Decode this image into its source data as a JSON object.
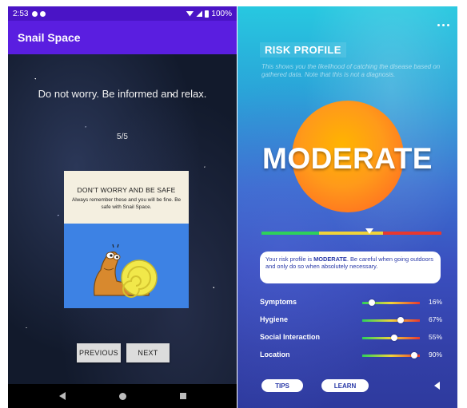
{
  "left_screen": {
    "status_bar": {
      "time": "2:53",
      "battery": "100%"
    },
    "app_title": "Snail Space",
    "headline": "Do not worry. Be informed and relax.",
    "page_counter": "5/5",
    "card": {
      "title": "DON'T WORRY AND BE SAFE",
      "body": "Always remember these and you will be fine. Be safe with Snail Space."
    },
    "buttons": {
      "previous": "PREVIOUS",
      "next": "NEXT"
    },
    "icons": [
      "notification-icon",
      "settings-icon",
      "wifi-icon",
      "signal-icon",
      "battery-icon",
      "back-icon",
      "home-icon",
      "recent-apps-icon"
    ]
  },
  "right_screen": {
    "title": "RISK PROFILE",
    "description": "This shows you the likelihood of catching the disease based on gathered data. Note that this is not a diagnosis.",
    "risk_level": "MODERATE",
    "risk_meter_position": 0.6,
    "advice": {
      "prefix": "Your risk profile is ",
      "level": "MODERATE",
      "suffix": ". Be careful when going outdoors and only do so when absolutely necessary."
    },
    "factors": [
      {
        "label": "Symptoms",
        "value": "16%",
        "fraction": 0.16
      },
      {
        "label": "Hygiene",
        "value": "67%",
        "fraction": 0.67
      },
      {
        "label": "Social Interaction",
        "value": "55%",
        "fraction": 0.55
      },
      {
        "label": "Location",
        "value": "90%",
        "fraction": 0.9
      }
    ],
    "buttons": {
      "tips": "TIPS",
      "learn": "LEARN"
    },
    "colors": {
      "low": "#2ed15a",
      "moderate": "#f0d43a",
      "high": "#e8382f",
      "accent": "#2a3aa8"
    }
  }
}
